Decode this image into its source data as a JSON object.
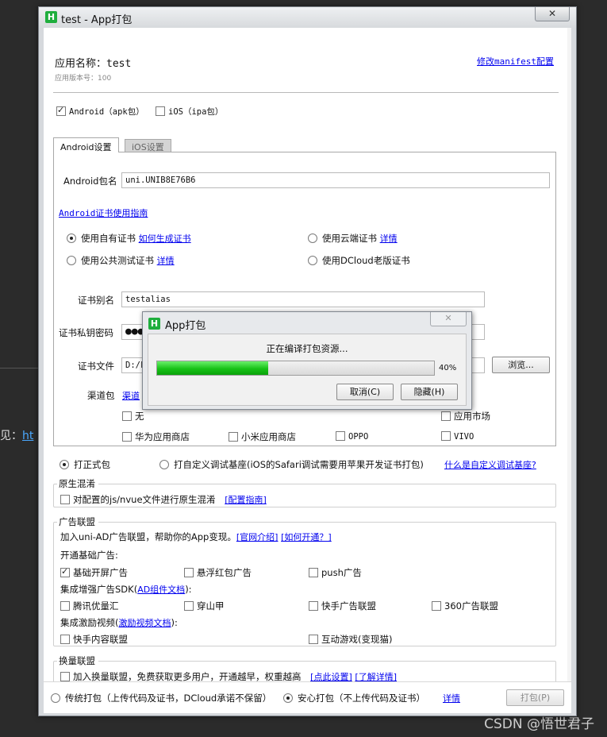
{
  "background": {
    "hint_prefix": "见：",
    "hint_link": "ht",
    "watermark": "CSDN @悟世君子"
  },
  "window": {
    "title": "test - App打包",
    "icon_letter": "H",
    "close_symbol": "✕"
  },
  "header": {
    "app_name_label": "应用名称：",
    "app_name_value": "test",
    "version": "应用版本号：100",
    "manifest_link": "修改manifest配置"
  },
  "platforms": {
    "android": {
      "label": "Android（apk包）",
      "checked": true
    },
    "ios": {
      "label": "iOS（ipa包）",
      "checked": false
    }
  },
  "tabs": [
    {
      "label": "Android设置",
      "active": true
    },
    {
      "label": "iOS设置",
      "active": false
    }
  ],
  "android": {
    "package_label": "Android包名",
    "package_value": "uni.UNIB8E76B6",
    "cert_guide_link": "Android证书使用指南",
    "cert_options": [
      {
        "label": "使用自有证书",
        "link": "如何生成证书",
        "selected": true
      },
      {
        "label": "使用云端证书",
        "link": "详情",
        "selected": false
      },
      {
        "label": "使用公共测试证书",
        "link": "详情",
        "selected": false
      },
      {
        "label": "使用DCloud老版证书",
        "link": "",
        "selected": false
      }
    ],
    "alias_label": "证书别名",
    "alias_value": "testalias",
    "password_label": "证书私钥密码",
    "password_value": "●●●",
    "file_label": "证书文件",
    "file_value": "D:/k",
    "browse_button": "浏览...",
    "channel_label": "渠道包",
    "channel_link": "渠道",
    "channels": [
      {
        "label": "无",
        "checked": false
      },
      {
        "label": "应用市场",
        "checked": false
      },
      {
        "label": "华为应用商店",
        "checked": false
      },
      {
        "label": "小米应用商店",
        "checked": false
      },
      {
        "label": "OPPO",
        "checked": false
      },
      {
        "label": "VIVO",
        "checked": false
      }
    ]
  },
  "build_type": {
    "formal": {
      "label": "打正式包",
      "selected": true
    },
    "custom": {
      "label": "打自定义调试基座(iOS的Safari调试需要用苹果开发证书打包)",
      "selected": false
    },
    "custom_link": "什么是自定义调试基座?"
  },
  "obfuscation": {
    "title": "原生混淆",
    "option": "对配置的js/nvue文件进行原生混淆",
    "link": "[配置指南]"
  },
  "ads": {
    "title": "广告联盟",
    "intro": "加入uni-AD广告联盟，帮助你的App变现。",
    "intro_links": [
      "[官网介绍]",
      "[如何开通？]"
    ],
    "basic_title": "开通基础广告:",
    "basic": [
      {
        "label": "基础开屏广告",
        "checked": true
      },
      {
        "label": "悬浮红包广告",
        "checked": false
      },
      {
        "label": "push广告",
        "checked": false
      }
    ],
    "sdk_title_prefix": "集成增强广告SDK(",
    "sdk_title_link": "AD组件文档",
    "sdk_title_suffix": "):",
    "sdk": [
      {
        "label": "腾讯优量汇",
        "checked": false
      },
      {
        "label": "穿山甲",
        "checked": false
      },
      {
        "label": "快手广告联盟",
        "checked": false
      },
      {
        "label": "360广告联盟",
        "checked": false
      }
    ],
    "video_title_prefix": "集成激励视频(",
    "video_title_link": "激励视频文档",
    "video_title_suffix": "):",
    "video": [
      {
        "label": "快手内容联盟",
        "checked": false
      },
      {
        "label": "互动游戏(变现猫)",
        "checked": false
      }
    ]
  },
  "exchange": {
    "title": "换量联盟",
    "option": "加入换量联盟，免费获取更多用户，开通越早，权重越高",
    "links": [
      "[点此设置]",
      "[了解详情]"
    ]
  },
  "footer": {
    "traditional": {
      "label": "传统打包（上传代码及证书，DCloud承诺不保留）",
      "selected": false
    },
    "safe": {
      "label": "安心打包（不上传代码及证书）",
      "selected": true
    },
    "detail_link": "详情",
    "pack_button": "打包(P)"
  },
  "modal": {
    "title": "App打包",
    "icon_letter": "H",
    "close_symbol": "✕",
    "status": "正在编译打包资源...",
    "progress": 0.4,
    "progress_text": "40%",
    "cancel_button": "取消(C)",
    "hide_button": "隐藏(H)"
  },
  "colors": {
    "link": "#0000ee",
    "progress_green": "#17c217",
    "app_icon": "#1fae3d"
  }
}
